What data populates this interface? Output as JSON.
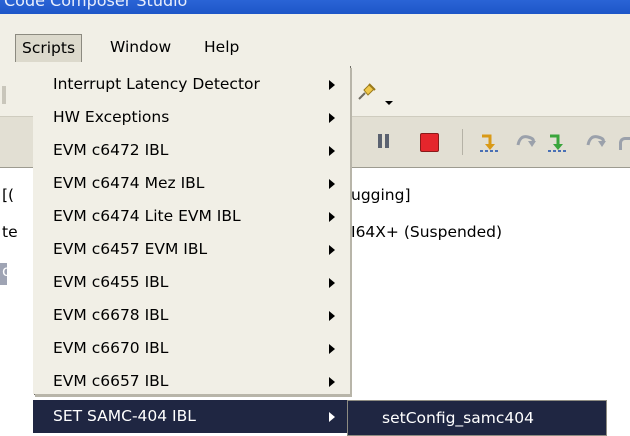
{
  "window": {
    "title": "Code Composer Studio"
  },
  "menubar": {
    "items": [
      "Scripts",
      "Window",
      "Help"
    ]
  },
  "scripts_menu": {
    "items": [
      {
        "label": "Interrupt Latency Detector",
        "submenu": true
      },
      {
        "label": "HW Exceptions",
        "submenu": true
      },
      {
        "label": "EVM c6472 IBL",
        "submenu": true
      },
      {
        "label": "EVM c6474 Mez IBL",
        "submenu": true
      },
      {
        "label": "EVM c6474 Lite EVM IBL",
        "submenu": true
      },
      {
        "label": "EVM c6457 EVM IBL",
        "submenu": true
      },
      {
        "label": "EVM c6455 IBL",
        "submenu": true
      },
      {
        "label": "EVM c6678 IBL",
        "submenu": true
      },
      {
        "label": "EVM c6670 IBL",
        "submenu": true
      },
      {
        "label": "EVM c6657 IBL",
        "submenu": true
      },
      {
        "label": "SET SAMC-404 IBL",
        "submenu": true,
        "selected": true
      }
    ]
  },
  "submenu": {
    "items": [
      "setConfig_samc404"
    ]
  },
  "editor": {
    "line1_left": "[(",
    "line1_right": "ugging]",
    "line2_left": "te",
    "line2_right": "I64X+ (Suspended)",
    "line3_left": "o"
  },
  "colors": {
    "menu_bg": "#f1efe6",
    "selection_bg": "#1f2642",
    "selection_text": "#ffffff",
    "titlebar": "#2a64d6",
    "stop_red": "#e5262c"
  },
  "icons": [
    "pin-icon",
    "dropdown-arrow-icon",
    "pause-icon",
    "stop-icon",
    "step-into-icon",
    "step-over-icon",
    "step-return-icon"
  ]
}
